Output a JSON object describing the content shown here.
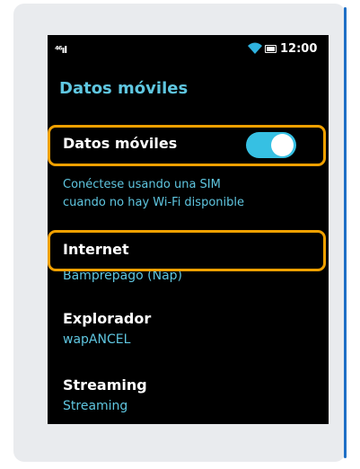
{
  "status_bar": {
    "signal_text": "⁴⁶ıl",
    "time": "12:00",
    "icons": [
      "signal-icon",
      "wifi-icon",
      "battery-icon"
    ]
  },
  "screen": {
    "title": "Datos móviles"
  },
  "mobile_data": {
    "label": "Datos móviles",
    "toggle_on": true,
    "description_line1": "Conéctese usando una SIM",
    "description_line2": "cuando no hay Wi-Fi disponible"
  },
  "settings": [
    {
      "label": "Internet",
      "value": "Bamprepago (Nap)"
    },
    {
      "label": "Explorador",
      "value": "wapANCEL"
    },
    {
      "label": "Streaming",
      "value": "Streaming"
    }
  ],
  "colors": {
    "accent": "#5fc6e0",
    "toggle": "#36c0e3",
    "highlight": "#f0a000",
    "screen_bg": "#000000"
  }
}
